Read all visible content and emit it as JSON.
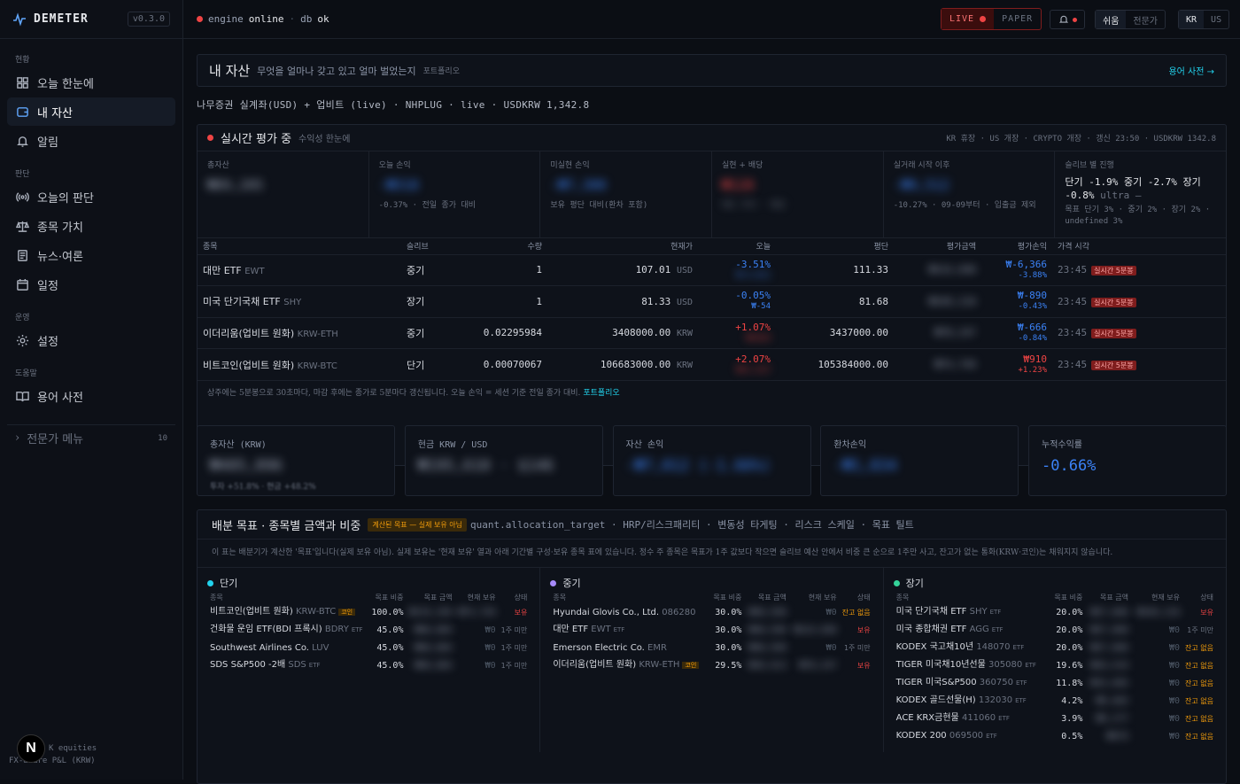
{
  "brand": {
    "name": "DEMETER",
    "version": "v0.3.0"
  },
  "sidebar": {
    "sections": [
      "현황",
      "판단",
      "운영",
      "도움말"
    ],
    "items": [
      {
        "label": "오늘 한눈에",
        "icon": "grid-icon"
      },
      {
        "label": "내 자산",
        "icon": "wallet-icon"
      },
      {
        "label": "알림",
        "icon": "bell-icon"
      },
      {
        "label": "오늘의 판단",
        "icon": "radio-icon"
      },
      {
        "label": "종목 가치",
        "icon": "scale-icon"
      },
      {
        "label": "뉴스·여론",
        "icon": "news-icon"
      },
      {
        "label": "일정",
        "icon": "calendar-icon"
      },
      {
        "label": "설정",
        "icon": "gear-icon"
      },
      {
        "label": "용어 사전",
        "icon": "book-icon"
      }
    ],
    "expert_label": "전문가 메뉴",
    "expert_count": "10",
    "footer_line1": "K equities",
    "footer_line2": "FX-aware P&L (KRW)"
  },
  "topbar": {
    "engine": "engine",
    "engine_state": "online",
    "db": "db",
    "db_state": "ok",
    "live": "LIVE",
    "paper": "PAPER",
    "mode1": "쉬움",
    "mode2": "전문가",
    "lang1": "KR",
    "lang2": "US"
  },
  "page": {
    "title": "내 자산",
    "subtitle": "무엇을 얼마나 갖고 있고 얼마 벌었는지",
    "tag": "포트폴리오",
    "glossary": "용어 사전 →",
    "account": "나무증권 실계좌(USD) + 업비트 (live) · NHPLUG · live · USDKRW 1,342.8"
  },
  "realtime": {
    "title": "실시간 평가 중",
    "subtitle": "수익성 한눈에",
    "status": "KR 휴장 · US 개장 · CRYPTO 개장 · 갱신 23:50 · USDKRW 1342.8",
    "kpis": [
      {
        "label": "총자산",
        "value": "₩89,205",
        "sub": ""
      },
      {
        "label": "오늘 손익",
        "value": "-₩318",
        "sub": "-0.37% · 전일 종가 대비"
      },
      {
        "label": "미실현 손익",
        "value": "-₩7,300",
        "sub": "보유 평단 대비(환차 포함)"
      },
      {
        "label": "실현 + 배당",
        "value": "₩128",
        "sub": "매도 차익 · 배당"
      },
      {
        "label": "실거래 시작 이후",
        "value": "-₩9,512",
        "sub": "-10.27% · 09-09부터 · 입출금 제외"
      },
      {
        "label": "슬리브 별 진행",
        "value": "단기 -1.9% 중기 -2.7% 장기",
        "value2": "-0.8%",
        "tag": "ultra —",
        "sub": "목표 단기 3% · 중기 2% · 장기 2% · undefined 3%"
      }
    ],
    "headers": [
      "종목",
      "슬리브",
      "수량",
      "현재가",
      "오늘",
      "평단",
      "평가금액",
      "평가손익",
      "가격 시각"
    ],
    "rows": [
      {
        "name": "대만 ETF",
        "ticker": "EWT",
        "sleeve": "중기",
        "qty": "1",
        "price": "107.01",
        "cur": "USD",
        "today": "-3.51%",
        "today2": "₩-4,811",
        "avg": "111.33",
        "value": "₩143,690",
        "pnl": "₩-6,366",
        "pnl2": "-3.88%",
        "time": "23:45",
        "badge": "실시간 5분봉",
        "dir": "dn"
      },
      {
        "name": "미국 단기국채 ETF",
        "ticker": "SHY",
        "sleeve": "장기",
        "qty": "1",
        "price": "81.33",
        "cur": "USD",
        "today": "-0.05%",
        "today2": "₩-54",
        "avg": "81.68",
        "value": "₩109,210",
        "pnl": "₩-890",
        "pnl2": "-0.43%",
        "time": "23:45",
        "badge": "실시간 5분봉",
        "dir": "dn"
      },
      {
        "name": "이더리움(업비트 원화)",
        "ticker": "KRW-ETH",
        "sleeve": "중기",
        "qty": "0.02295984",
        "price": "3408000.00",
        "cur": "KRW",
        "today": "+1.07%",
        "today2": "₩+824",
        "avg": "3437000.00",
        "value": "₩78,247",
        "pnl": "₩-666",
        "pnl2": "-0.84%",
        "time": "23:45",
        "badge": "실시간 5분봉",
        "dir": "up"
      },
      {
        "name": "비트코인(업비트 원화)",
        "ticker": "KRW-BTC",
        "sleeve": "단기",
        "qty": "0.00070067",
        "price": "106683000.00",
        "cur": "KRW",
        "today": "+2.07%",
        "today2": "₩+1,517",
        "avg": "105384000.00",
        "value": "₩74,749",
        "pnl": "₩910",
        "pnl2": "+1.23%",
        "time": "23:45",
        "badge": "실시간 5분봉",
        "dir": "up"
      }
    ],
    "note": "상주에는 5분봉으로 30초마다, 마감 후에는 종가로 5분마다 갱신됩니다. 오늘 손익 = 세션 기준 전일 종가 대비.",
    "note_link": "포트폴리오"
  },
  "summary": [
    {
      "label": "총자산 (KRW)",
      "value": "₩405,896",
      "sub": "투자 +51.8% · 현금 +48.2%"
    },
    {
      "label": "현금 KRW / USD",
      "value": "₩195,610 · $146",
      "sub": ""
    },
    {
      "label": "자산 손익",
      "value": "-₩7,012 (-1.66%)",
      "sub": ""
    },
    {
      "label": "환차손익",
      "value": "-₩1,834",
      "sub": ""
    },
    {
      "label": "누적수익률",
      "value": "-0.66%",
      "sub": ""
    }
  ],
  "alloc": {
    "title": "배분 목표 · 종목별 금액과 비중",
    "warn": "계산된 목표 — 실제 보유 아님",
    "meta": "quant.allocation_target · HRP/리스크패리티 · 변동성 타게팅 · 리스크 스케일 · 목표 틸트",
    "desc": "이 표는 배분기가 계산한 '목표'입니다(실제 보유 아님). 실제 보유는 '현재 보유' 열과 아래 기간별 구성·보유 종목 표에 있습니다. 정수 주 종목은 목표가 1주 값보다 작으면 슬리브 예산 안에서 비중 큰 순으로 1주만 사고, 잔고가 없는 통화(KRW·코인)는 채워지지 않습니다.",
    "headers": [
      "종목",
      "목표 비중",
      "목표 금액",
      "현재 보유",
      "상태"
    ],
    "cols": [
      {
        "name": "단기",
        "color": "#22d3ee",
        "rows": [
          {
            "n": "비트코인(업비트 원화)",
            "t": "KRW-BTC",
            "tag": "코인",
            "w": "100.0%",
            "a": "₩135,299",
            "h": "₩74,749",
            "s": "보유",
            "sc": "hold"
          },
          {
            "n": "건화물 운임 ETF(BDI 프록시)",
            "t": "BDRY",
            "tag": "ETF",
            "w": "45.0%",
            "a": "₩60,884",
            "h": "₩0",
            "s": "1주 미만",
            "sc": "low"
          },
          {
            "n": "Southwest Airlines Co.",
            "t": "LUV",
            "tag": "",
            "w": "45.0%",
            "a": "₩60,884",
            "h": "₩0",
            "s": "1주 미만",
            "sc": "low"
          },
          {
            "n": "SDS S&P500 -2배",
            "t": "SDS",
            "tag": "ETF",
            "w": "45.0%",
            "a": "₩60,884",
            "h": "₩0",
            "s": "1주 미만",
            "sc": "low"
          }
        ]
      },
      {
        "name": "중기",
        "color": "#a78bfa",
        "rows": [
          {
            "n": "Hyundai Glovis Co., Ltd.",
            "t": "086280",
            "tag": "",
            "w": "30.0%",
            "a": "₩40,590",
            "h": "₩0",
            "s": "잔고 없음",
            "sc": "nobal"
          },
          {
            "n": "대만 ETF",
            "t": "EWT",
            "tag": "ETF",
            "w": "30.0%",
            "a": "₩40,590",
            "h": "₩143,690",
            "s": "보유",
            "sc": "hold"
          },
          {
            "n": "Emerson Electric Co.",
            "t": "EMR",
            "tag": "",
            "w": "30.0%",
            "a": "₩40,590",
            "h": "₩0",
            "s": "1주 미만",
            "sc": "low"
          },
          {
            "n": "이더리움(업비트 원화)",
            "t": "KRW-ETH",
            "tag": "코인",
            "w": "29.5%",
            "a": "₩39,913",
            "h": "₩78,247",
            "s": "보유",
            "sc": "hold"
          }
        ]
      },
      {
        "name": "장기",
        "color": "#34d399",
        "rows": [
          {
            "n": "미국 단기국채 ETF",
            "t": "SHY",
            "tag": "ETF",
            "w": "20.0%",
            "a": "₩27,060",
            "h": "₩109,210",
            "s": "보유",
            "sc": "hold"
          },
          {
            "n": "미국 종합채권 ETF",
            "t": "AGG",
            "tag": "ETF",
            "w": "20.0%",
            "a": "₩27,060",
            "h": "₩0",
            "s": "1주 미만",
            "sc": "low"
          },
          {
            "n": "KODEX 국고채10년",
            "t": "148070",
            "tag": "ETF",
            "w": "20.0%",
            "a": "₩27,060",
            "h": "₩0",
            "s": "잔고 없음",
            "sc": "nobal"
          },
          {
            "n": "TIGER 미국채10년선물",
            "t": "305080",
            "tag": "ETF",
            "w": "19.6%",
            "a": "₩26,519",
            "h": "₩0",
            "s": "잔고 없음",
            "sc": "nobal"
          },
          {
            "n": "TIGER 미국S&P500",
            "t": "360750",
            "tag": "ETF",
            "w": "11.8%",
            "a": "₩15,965",
            "h": "₩0",
            "s": "잔고 없음",
            "sc": "nobal"
          },
          {
            "n": "KODEX 골드선물(H)",
            "t": "132030",
            "tag": "ETF",
            "w": "4.2%",
            "a": "₩5,683",
            "h": "₩0",
            "s": "잔고 없음",
            "sc": "nobal"
          },
          {
            "n": "ACE KRX금현물",
            "t": "411060",
            "tag": "ETF",
            "w": "3.9%",
            "a": "₩5,277",
            "h": "₩0",
            "s": "잔고 없음",
            "sc": "nobal"
          },
          {
            "n": "KODEX 200",
            "t": "069500",
            "tag": "ETF",
            "w": "0.5%",
            "a": "₩676",
            "h": "₩0",
            "s": "잔고 없음",
            "sc": "nobal"
          }
        ]
      }
    ]
  }
}
